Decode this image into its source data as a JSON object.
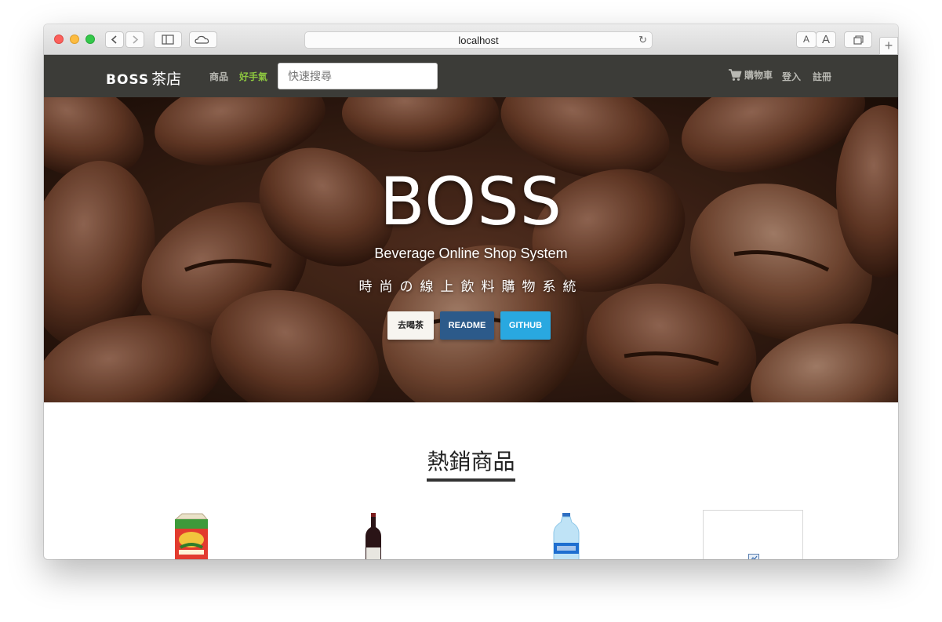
{
  "browser": {
    "url": "localhost",
    "font_small_label": "A",
    "font_large_label": "A"
  },
  "navbar": {
    "brand_en": "BOSS",
    "brand_zh": "茶店",
    "links": [
      {
        "label": "商品",
        "active": false
      },
      {
        "label": "好手氣",
        "active": true
      }
    ],
    "search": {
      "placeholder": "快速搜尋",
      "value": ""
    },
    "right_links": {
      "cart": "購物車",
      "login": "登入",
      "register": "註冊"
    }
  },
  "hero": {
    "title": "BOSS",
    "subtitle": "Beverage Online Shop System",
    "tagline": "時尚の線上飲料購物系統",
    "buttons": [
      {
        "label": "去喝茶",
        "bg": "#f7f5f0",
        "color": "#222222"
      },
      {
        "label": "README",
        "bg": "#2c5a8a",
        "color": "#ffffff"
      },
      {
        "label": "GITHUB",
        "bg": "#29a8e0",
        "color": "#ffffff"
      }
    ]
  },
  "bestsellers": {
    "title": "熱銷商品",
    "products": [
      {
        "icon": "juice-box-icon"
      },
      {
        "icon": "wine-bottle-icon"
      },
      {
        "icon": "water-bottle-icon"
      },
      {
        "icon": "broken-image-icon"
      }
    ]
  },
  "colors": {
    "navbar_bg": "#3c3c38",
    "accent_green": "#8cc63f",
    "nav_text": "#b9b9b3"
  }
}
